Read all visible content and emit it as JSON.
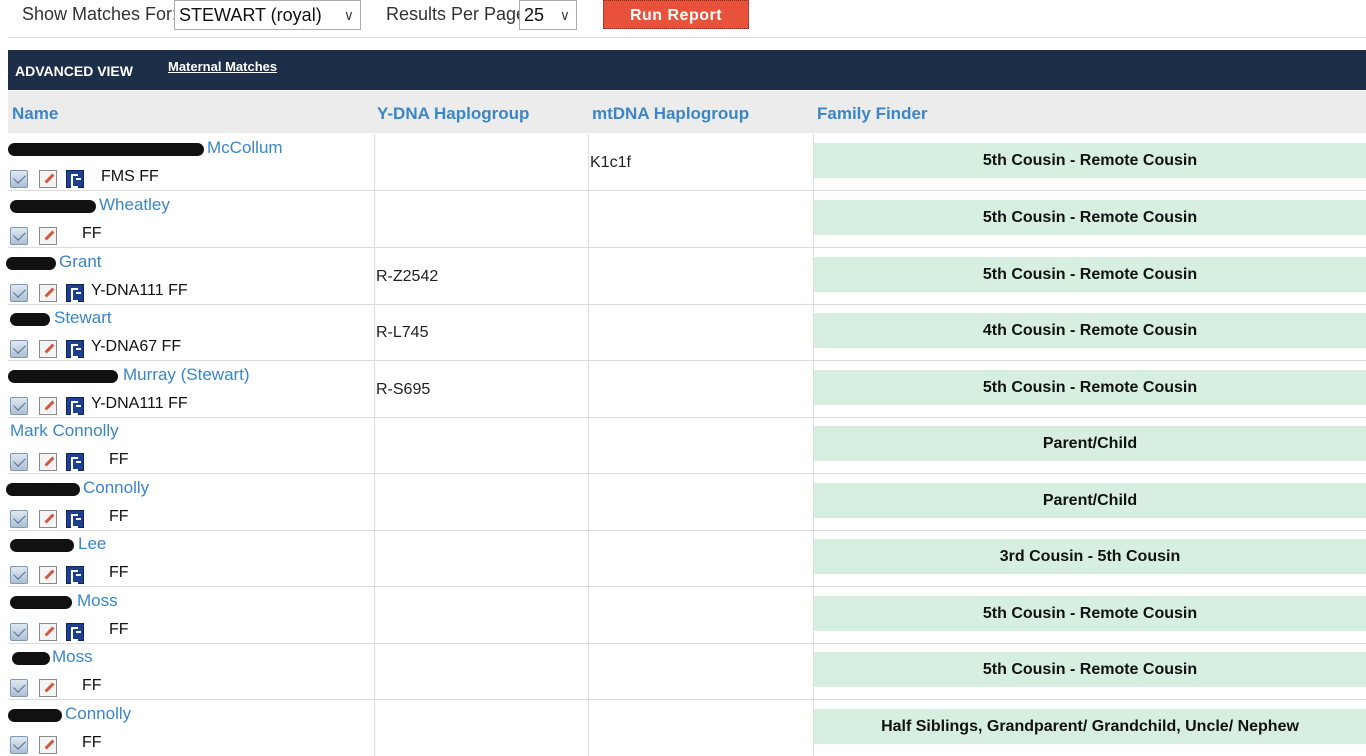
{
  "controls": {
    "show_matches_label": "Show Matches For:",
    "show_matches_value": "STEWART (royal)",
    "results_per_page_label": "Results Per Page",
    "results_per_page_value": "25",
    "run_report_label": "Run Report"
  },
  "view_bar": {
    "advanced_view_label": "ADVANCED VIEW",
    "maternal_matches_link": "Maternal Matches"
  },
  "columns": {
    "name": "Name",
    "ydna": "Y-DNA Haplogroup",
    "mtdna": "mtDNA Haplogroup",
    "family_finder": "Family Finder"
  },
  "rows": [
    {
      "name": "McCollum",
      "tests": "FMS  FF",
      "ydna": "",
      "mtdna": "K1c1f",
      "relationship": "5th Cousin - Remote Cousin"
    },
    {
      "name": "Wheatley",
      "tests": "FF",
      "ydna": "",
      "mtdna": "",
      "relationship": "5th Cousin - Remote Cousin"
    },
    {
      "name": "Grant",
      "tests": "Y-DNA111    FF",
      "ydna": "R-Z2542",
      "mtdna": "",
      "relationship": "5th Cousin - Remote Cousin"
    },
    {
      "name": "Stewart",
      "tests": "Y-DNA67    FF",
      "ydna": "R-L745",
      "mtdna": "",
      "relationship": "4th Cousin - Remote Cousin"
    },
    {
      "name": "Murray (Stewart)",
      "tests": "Y-DNA111    FF",
      "ydna": "R-S695",
      "mtdna": "",
      "relationship": "5th Cousin - Remote Cousin"
    },
    {
      "name": "Mark Connolly",
      "tests": "FF",
      "ydna": "",
      "mtdna": "",
      "relationship": "Parent/Child"
    },
    {
      "name": "Connolly",
      "tests": "FF",
      "ydna": "",
      "mtdna": "",
      "relationship": "Parent/Child"
    },
    {
      "name": "Lee",
      "tests": "FF",
      "ydna": "",
      "mtdna": "",
      "relationship": "3rd Cousin - 5th Cousin"
    },
    {
      "name": "Moss",
      "tests": "FF",
      "ydna": "",
      "mtdna": "",
      "relationship": "5th Cousin - Remote Cousin"
    },
    {
      "name": "Moss",
      "tests": "FF",
      "ydna": "",
      "mtdna": "",
      "relationship": "5th Cousin - Remote Cousin"
    },
    {
      "name": "Connolly",
      "tests": "FF",
      "ydna": "",
      "mtdna": "",
      "relationship": "Half Siblings, Grandparent/ Grandchild, Uncle/ Nephew"
    }
  ],
  "icons": [
    "email-icon",
    "notes-icon",
    "family-tree-icon"
  ],
  "colors": {
    "header_bar": "#1d2e48",
    "link_blue": "#3a86c8",
    "run_button": "#e8523a",
    "relationship_bg": "#d6efe0"
  }
}
